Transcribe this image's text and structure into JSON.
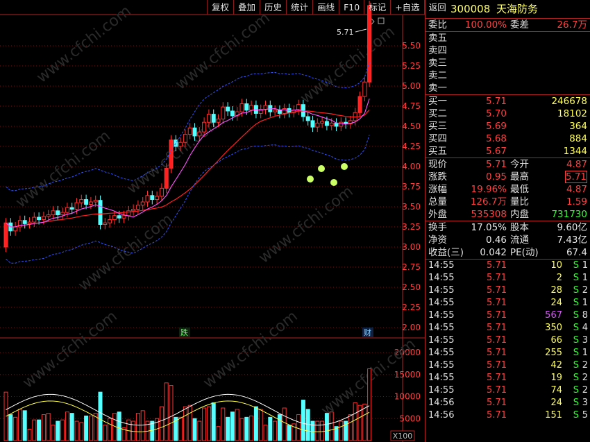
{
  "toolbar": [
    "复权",
    "叠加",
    "历史",
    "统计",
    "画线",
    "F10",
    "标记",
    "+自选",
    "返回"
  ],
  "chart": {
    "price_axis": [
      "5.50",
      "5.25",
      "5.00",
      "4.75",
      "4.50",
      "4.25",
      "4.00",
      "3.75",
      "3.50",
      "3.25",
      "3.00",
      "2.75",
      "2.50",
      "2.25",
      "2.00"
    ],
    "volume_axis": [
      "20000",
      "15000",
      "10000",
      "5000"
    ],
    "volume_unit": "X100",
    "high_marker": "5.71",
    "event_labels": [
      "跌",
      "财"
    ],
    "watermark": "www.cfchi.com"
  },
  "quote": {
    "code": "300008",
    "name": "天海防务",
    "weibi_label": "委比",
    "weibi": "100.00%",
    "weicha_label": "委差",
    "weicha": "26.7万",
    "sell": [
      {
        "label": "卖五",
        "price": "",
        "vol": ""
      },
      {
        "label": "卖四",
        "price": "",
        "vol": ""
      },
      {
        "label": "卖三",
        "price": "",
        "vol": ""
      },
      {
        "label": "卖二",
        "price": "",
        "vol": ""
      },
      {
        "label": "卖一",
        "price": "",
        "vol": ""
      }
    ],
    "buy": [
      {
        "label": "买一",
        "price": "5.71",
        "vol": "246678"
      },
      {
        "label": "买二",
        "price": "5.70",
        "vol": "18102"
      },
      {
        "label": "买三",
        "price": "5.69",
        "vol": "364"
      },
      {
        "label": "买四",
        "price": "5.68",
        "vol": "884"
      },
      {
        "label": "买五",
        "price": "5.67",
        "vol": "1344"
      }
    ],
    "stats": [
      {
        "l1": "现价",
        "v1": "5.71",
        "l2": "今开",
        "v2": "4.87"
      },
      {
        "l1": "涨跌",
        "v1": "0.95",
        "l2": "最高",
        "v2": "5.71"
      },
      {
        "l1": "涨幅",
        "v1": "19.96%",
        "l2": "最低",
        "v2": "4.87"
      },
      {
        "l1": "总量",
        "v1": "126.7万",
        "l2": "量比",
        "v2": "1.59"
      },
      {
        "l1": "外盘",
        "v1": "535308",
        "l2": "内盘",
        "v2": "731730"
      }
    ],
    "stats2": [
      {
        "l1": "换手",
        "v1": "17.05%",
        "l2": "股本",
        "v2": "9.60亿"
      },
      {
        "l1": "净资",
        "v1": "0.46",
        "l2": "流通",
        "v2": "7.43亿"
      },
      {
        "l1": "收益(三)",
        "v1": "0.042",
        "l2": "PE(动)",
        "v2": "67.4"
      }
    ],
    "ticks": [
      {
        "time": "14:55",
        "price": "5.71",
        "vol": "10",
        "bs": "S",
        "n": "1"
      },
      {
        "time": "14:55",
        "price": "5.71",
        "vol": "2",
        "bs": "S",
        "n": "1"
      },
      {
        "time": "14:55",
        "price": "5.71",
        "vol": "28",
        "bs": "S",
        "n": "2"
      },
      {
        "time": "14:55",
        "price": "5.71",
        "vol": "24",
        "bs": "S",
        "n": "1"
      },
      {
        "time": "14:55",
        "price": "5.71",
        "vol": "567",
        "bs": "S",
        "n": "8"
      },
      {
        "time": "14:55",
        "price": "5.71",
        "vol": "350",
        "bs": "S",
        "n": "4"
      },
      {
        "time": "14:55",
        "price": "5.71",
        "vol": "66",
        "bs": "S",
        "n": "3"
      },
      {
        "time": "14:55",
        "price": "5.71",
        "vol": "255",
        "bs": "S",
        "n": "1"
      },
      {
        "time": "14:55",
        "price": "5.71",
        "vol": "42",
        "bs": "S",
        "n": "2"
      },
      {
        "time": "14:55",
        "price": "5.71",
        "vol": "19",
        "bs": "S",
        "n": "2"
      },
      {
        "time": "14:55",
        "price": "5.71",
        "vol": "74",
        "bs": "S",
        "n": "2"
      },
      {
        "time": "14:56",
        "price": "5.71",
        "vol": "24",
        "bs": "S",
        "n": "3"
      },
      {
        "time": "14:56",
        "price": "5.71",
        "vol": "151",
        "bs": "S",
        "n": "5"
      }
    ]
  }
}
